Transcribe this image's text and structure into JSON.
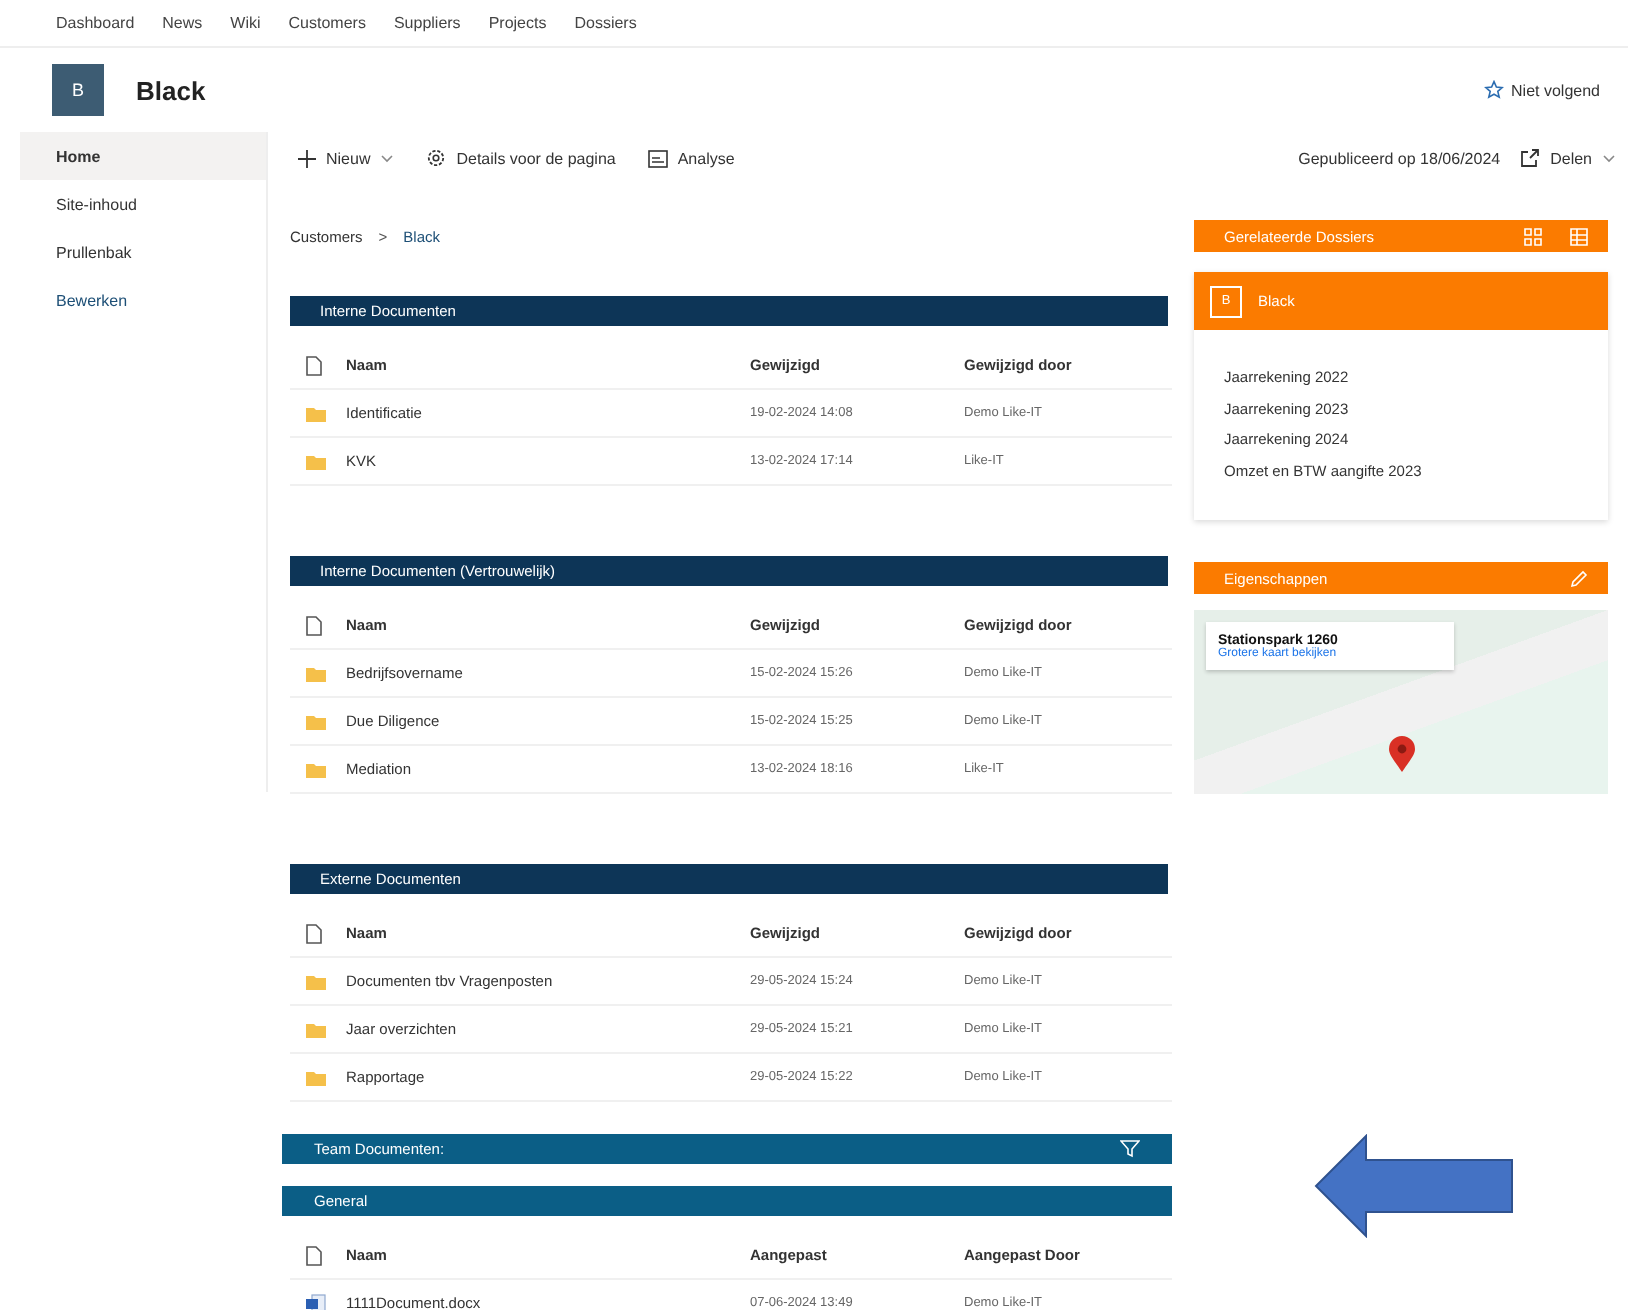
{
  "top_nav": [
    "Dashboard",
    "News",
    "Wiki",
    "Customers",
    "Suppliers",
    "Projects",
    "Dossiers"
  ],
  "site": {
    "logo_letter": "B",
    "title": "Black",
    "follow": "Niet volgend"
  },
  "sidebar": {
    "items": [
      {
        "label": "Home",
        "selected": true
      },
      {
        "label": "Site-inhoud",
        "selected": false
      },
      {
        "label": "Prullenbak",
        "selected": false
      }
    ],
    "edit_link": "Bewerken"
  },
  "toolbar": {
    "new": "Nieuw",
    "details": "Details voor de pagina",
    "analysis": "Analyse",
    "published": "Gepubliceerd op 18/06/2024",
    "share": "Delen"
  },
  "breadcrumb": {
    "items": [
      "Customers",
      "Black"
    ],
    "separator": ">"
  },
  "sections": [
    {
      "kind": "library",
      "title": "Interne Documenten",
      "color": "#0d3557",
      "columns": [
        "Naam",
        "Gewijzigd",
        "Gewijzigd door"
      ],
      "rows": [
        {
          "kind": "folder",
          "name": "Identificatie",
          "modified": "19-02-2024 14:08",
          "by": "Demo Like-IT"
        },
        {
          "kind": "folder",
          "name": "KVK",
          "modified": "13-02-2024 17:14",
          "by": "Like-IT"
        }
      ]
    },
    {
      "kind": "library",
      "title": "Interne Documenten (Vertrouwelijk)",
      "color": "#0d3557",
      "columns": [
        "Naam",
        "Gewijzigd",
        "Gewijzigd door"
      ],
      "rows": [
        {
          "kind": "folder",
          "name": "Bedrijfsovername",
          "modified": "15-02-2024 15:26",
          "by": "Demo Like-IT"
        },
        {
          "kind": "folder",
          "name": "Due Diligence",
          "modified": "15-02-2024 15:25",
          "by": "Demo Like-IT"
        },
        {
          "kind": "folder",
          "name": "Mediation",
          "modified": "13-02-2024 18:16",
          "by": "Like-IT"
        }
      ]
    },
    {
      "kind": "library",
      "title": "Externe Documenten",
      "color": "#0d3557",
      "columns": [
        "Naam",
        "Gewijzigd",
        "Gewijzigd door"
      ],
      "rows": [
        {
          "kind": "folder",
          "name": "Documenten tbv Vragenposten",
          "modified": "29-05-2024 15:24",
          "by": "Demo Like-IT"
        },
        {
          "kind": "folder",
          "name": "Jaar overzichten",
          "modified": "29-05-2024 15:21",
          "by": "Demo Like-IT"
        },
        {
          "kind": "folder",
          "name": "Rapportage",
          "modified": "29-05-2024 15:22",
          "by": "Demo Like-IT"
        }
      ]
    },
    {
      "kind": "filter_bar",
      "title": "Team Documenten:",
      "color": "#0b5e86"
    },
    {
      "kind": "library",
      "title": "General",
      "color": "#0b5e86",
      "columns": [
        "Naam",
        "Aangepast",
        "Aangepast Door"
      ],
      "rows": [
        {
          "kind": "docx",
          "name": "1111Document.docx",
          "modified": "07-06-2024 13:49",
          "by": "Demo Like-IT"
        }
      ]
    }
  ],
  "related": {
    "title": "Gerelateerde Dossiers",
    "dossier": {
      "letter": "B",
      "name": "Black"
    },
    "items": [
      "Jaarrekening 2022",
      "Jaarrekening 2023",
      "Jaarrekening 2024",
      "Omzet en BTW aangifte 2023"
    ]
  },
  "properties": {
    "title": "Eigenschappen",
    "map": {
      "place": "Stationspark 1260",
      "link": "Grotere kaart bekijken"
    }
  }
}
